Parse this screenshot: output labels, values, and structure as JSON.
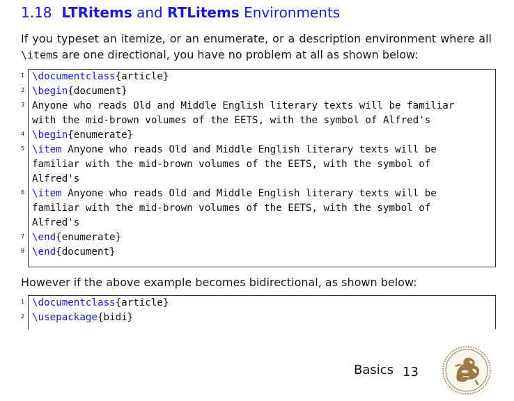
{
  "section": {
    "number": "1.18",
    "title_part1": "LTRitems",
    "title_and": "and",
    "title_part2": "RTLitems",
    "title_rest": "Environments"
  },
  "intro": {
    "text_a": "If you typeset an itemize, or an enumerate, or a description environment where all ",
    "code": "\\item",
    "text_b": "s are one directional, you have no problem at all as shown below:"
  },
  "code1": [
    {
      "num": "1",
      "kw": "\\documentclass",
      "rest": "{article}"
    },
    {
      "num": "2",
      "kw": "\\begin",
      "rest": "{document}"
    },
    {
      "num": "3",
      "kw": "",
      "rest": "Anyone who reads Old and Middle English literary texts will be familiar"
    },
    {
      "num": "",
      "kw": "",
      "rest": "with the mid-brown volumes of the EETS, with the symbol of Alfred's"
    },
    {
      "num": "4",
      "kw": "\\begin",
      "rest": "{enumerate}"
    },
    {
      "num": "5",
      "kw": "\\item",
      "rest": " Anyone who reads Old and Middle English literary texts will be"
    },
    {
      "num": "",
      "kw": "",
      "rest": "familiar with the mid-brown volumes of the EETS, with the symbol of"
    },
    {
      "num": "",
      "kw": "",
      "rest": "Alfred's"
    },
    {
      "num": "6",
      "kw": "\\item",
      "rest": " Anyone who reads Old and Middle English literary texts will be"
    },
    {
      "num": "",
      "kw": "",
      "rest": "familiar with the mid-brown volumes of the EETS, with the symbol of"
    },
    {
      "num": "",
      "kw": "",
      "rest": "Alfred's"
    },
    {
      "num": "7",
      "kw": "\\end",
      "rest": "{enumerate}"
    },
    {
      "num": "8",
      "kw": "\\end",
      "rest": "{document}"
    }
  ],
  "however": "However if the above example becomes bidirectional, as shown below:",
  "code2": [
    {
      "num": "1",
      "kw": "\\documentclass",
      "rest": "{article}"
    },
    {
      "num": "2",
      "kw": "\\usepackage",
      "rest": "{bidi}"
    }
  ],
  "footer": {
    "label": "Basics",
    "page": "13"
  },
  "colors": {
    "accent": "#1a1ad6",
    "emblem": "#9c7a45"
  },
  "icons": {
    "emblem": "griffin-seal-icon"
  }
}
